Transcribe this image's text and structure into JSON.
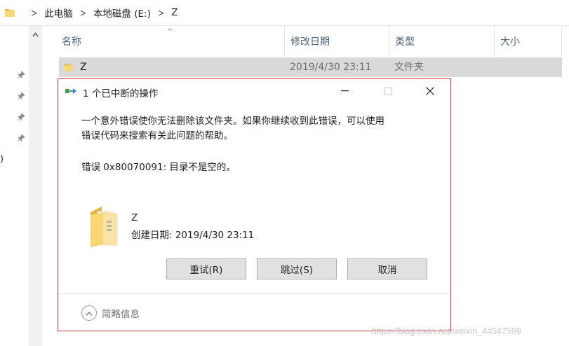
{
  "address": {
    "crumbs": [
      "此电脑",
      "本地磁盘 (E:)",
      "Z"
    ],
    "icons": [
      "folder-icon",
      "chevron-right-icon"
    ]
  },
  "left_nav": {
    "cut_text": ")",
    "pins": 4
  },
  "columns": {
    "name": "名称",
    "modified": "修改日期",
    "type": "类型",
    "size": "大小"
  },
  "file_row": {
    "name": "Z",
    "modified": "2019/4/30 23:11",
    "type": "文件夹"
  },
  "dialog": {
    "title": "1 个已中断的操作",
    "message_line1": "一个意外错误使你无法删除该文件夹。如果你继续收到此错误，可以使用",
    "message_line2": "错误代码来搜索有关此问题的帮助。",
    "error": "错误 0x80070091: 目录不是空的。",
    "item_name": "Z",
    "item_date": "创建日期: 2019/4/30 23:11",
    "buttons": {
      "retry": "重试(R)",
      "skip": "跳过(S)",
      "cancel": "取消"
    },
    "less_info": "简略信息",
    "colors": {
      "border": "#d7343f",
      "button_bg": "#e1e1e1",
      "selected_row": "#d9d9d9"
    }
  },
  "watermark": "https://blog.csdn.net/weixin_44547599"
}
